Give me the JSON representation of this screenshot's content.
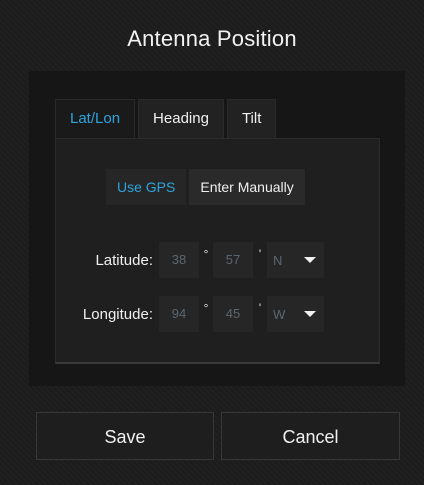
{
  "dialog": {
    "title": "Antenna Position"
  },
  "tabs": [
    {
      "label": "Lat/Lon",
      "active": true
    },
    {
      "label": "Heading",
      "active": false
    },
    {
      "label": "Tilt",
      "active": false
    }
  ],
  "mode": {
    "use_gps_label": "Use GPS",
    "enter_manually_label": "Enter Manually",
    "selected": "Use GPS"
  },
  "latitude": {
    "label": "Latitude:",
    "degrees": "38",
    "degree_symbol": "°",
    "minutes": "57",
    "minute_symbol": "'",
    "direction": "N"
  },
  "longitude": {
    "label": "Longitude:",
    "degrees": "94",
    "degree_symbol": "°",
    "minutes": "45",
    "minute_symbol": "'",
    "direction": "W"
  },
  "buttons": {
    "save_label": "Save",
    "cancel_label": "Cancel"
  },
  "colors": {
    "accent": "#2ea4dd",
    "background": "#1c1c1c",
    "disabled_text": "#5b6670"
  }
}
